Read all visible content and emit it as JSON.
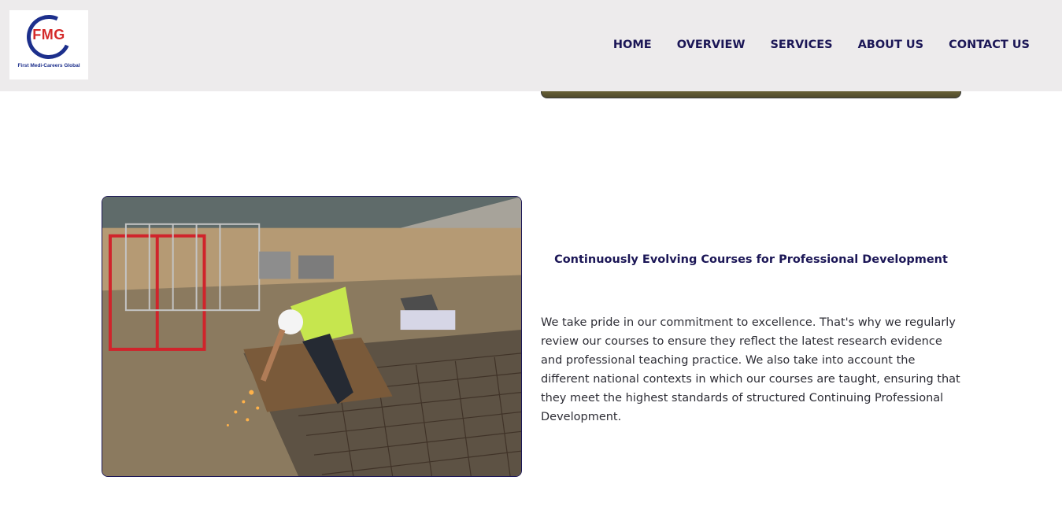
{
  "header": {
    "logo": {
      "mark": "FMG",
      "tagline": "First Medi-Careers Global"
    },
    "nav": [
      "HOME",
      "OVERVIEW",
      "SERVICES",
      "ABOUT US",
      "CONTACT US"
    ]
  },
  "feature": {
    "title": "Continuously Evolving Courses for Professional Development",
    "body": "We take pride in our commitment to excellence. That's why we regularly review our courses to ensure they reflect the latest research evidence and professional teaching practice. We also take into account the different national contexts in which our courses are taught, ensuring that they meet the highest standards of structured Continuing Professional Development.",
    "image_icon": "construction-worker-photo"
  },
  "colors": {
    "header_bg": "#edebec",
    "nav_text": "#1b1656",
    "logo_blue": "#1c2f8c",
    "logo_red": "#d42a2a"
  }
}
